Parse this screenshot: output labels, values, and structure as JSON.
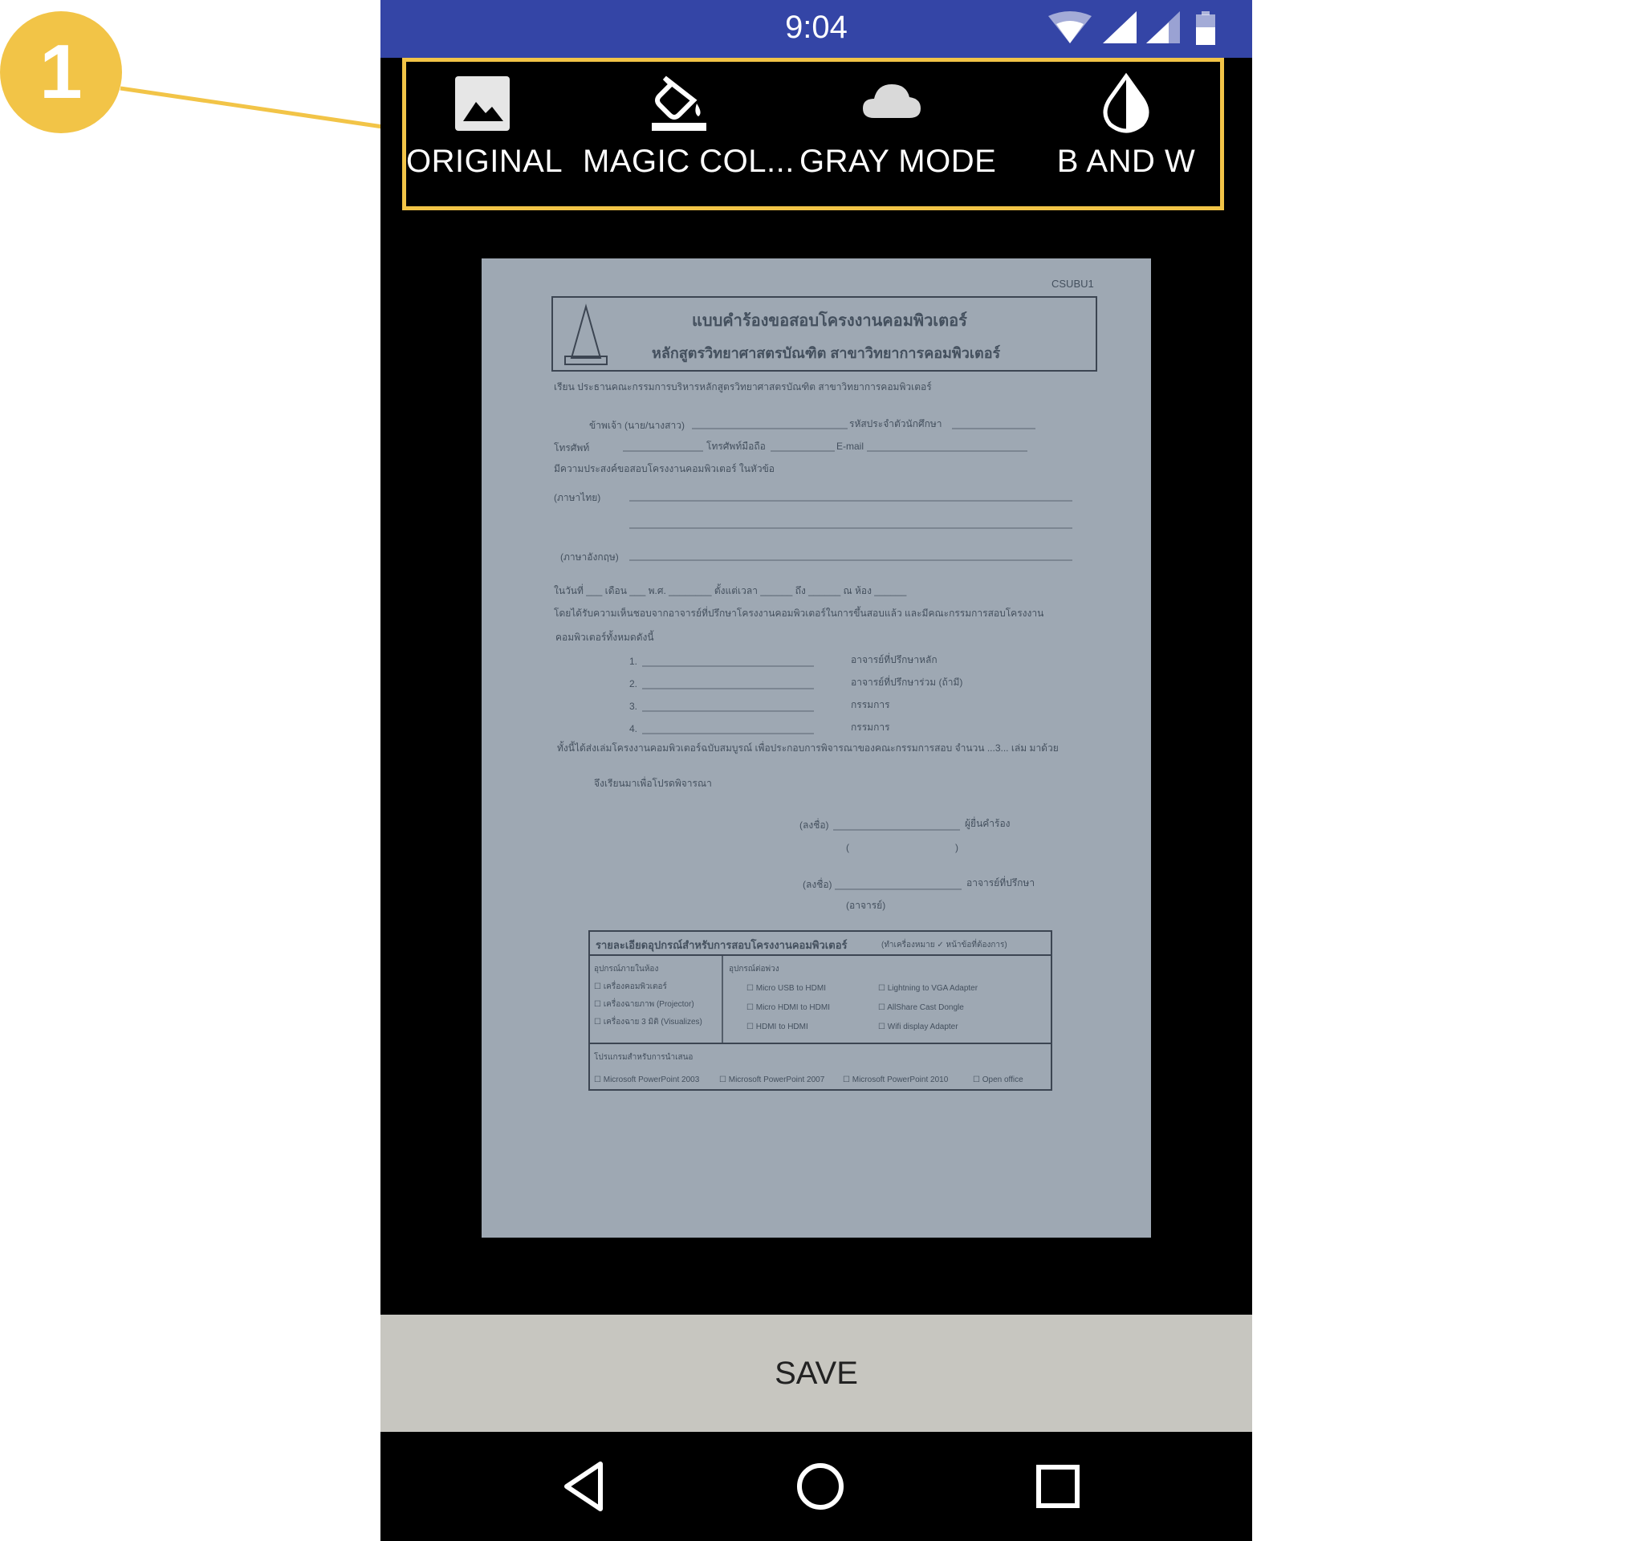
{
  "callout": {
    "number": "1",
    "color": "#f2c447"
  },
  "status_bar": {
    "time": "9:04",
    "background": "#3445a6",
    "icons": [
      "wifi-icon",
      "signal-icon",
      "signal-icon",
      "battery-icon"
    ]
  },
  "toolbar": {
    "items": [
      {
        "label": "ORIGINAL",
        "icon": "image-icon"
      },
      {
        "label": "MAGIC COL...",
        "icon": "paint-bucket-icon"
      },
      {
        "label": "GRAY MODE",
        "icon": "cloud-icon"
      },
      {
        "label": "B AND W",
        "icon": "contrast-drop-icon"
      }
    ],
    "highlight_color": "#f2c447"
  },
  "document": {
    "code": "CSUBU1",
    "title": "แบบคำร้องขอสอบโครงงานคอมพิวเตอร์",
    "subtitle": "หลักสูตรวิทยาศาสตรบัณฑิต สาขาวิทยาการคอมพิวเตอร์",
    "to_line": "เรียน ประธานคณะกรรมการบริหารหลักสูตรวิทยาศาสตรบัณฑิต สาขาวิทยาการคอมพิวเตอร์",
    "name_line": "ข้าพเจ้า (นาย/นางสาว)",
    "student_id": "รหัสประจำตัวนักศึกษา",
    "phone": "โทรศัพท์",
    "mobile": "โทรศัพท์มือถือ",
    "email": "E-mail",
    "purpose": "มีความประสงค์ขอสอบโครงงานคอมพิวเตอร์ ในหัวข้อ",
    "thai": "(ภาษาไทย)",
    "english": "(ภาษาอังกฤษ)",
    "date_line": "ในวันที่ ___ เดือน ___ พ.ศ. ________ ตั้งแต่เวลา ______ ถึง ______ ณ ห้อง ______",
    "approval_line": "โดยได้รับความเห็นชอบจากอาจารย์ที่ปรึกษาโครงงานคอมพิวเตอร์ในการขึ้นสอบแล้ว และมีคณะกรรมการสอบโครงงาน",
    "approval_line2": "คอมพิวเตอร์ทั้งหมดดังนี้",
    "committee": [
      {
        "no": "1.",
        "role": "อาจารย์ที่ปรึกษาหลัก"
      },
      {
        "no": "2.",
        "role": "อาจารย์ที่ปรึกษาร่วม (ถ้ามี)"
      },
      {
        "no": "3.",
        "role": "กรรมการ"
      },
      {
        "no": "4.",
        "role": "กรรมการ"
      }
    ],
    "submit_line": "ทั้งนี้ได้ส่งเล่มโครงงานคอมพิวเตอร์ฉบับสมบูรณ์ เพื่อประกอบการพิจารณาของคณะกรรมการสอบ จำนวน ...3... เล่ม มาด้วย",
    "closing": "จึงเรียนมาเพื่อโปรดพิจารณา",
    "sign1": "(ลงชื่อ)",
    "applicant": "ผู้ยื่นคำร้อง",
    "sign2": "(ลงชื่อ)",
    "advisor": "อาจารย์ที่ปรึกษา",
    "advisor_paren": "(อาจารย์)",
    "equip_title": "รายละเอียดอุปกรณ์สำหรับการสอบโครงงานคอมพิวเตอร์",
    "equip_note": "(ทำเครื่องหมาย ✓ หน้าข้อที่ต้องการ)",
    "room_equip_head": "อุปกรณ์ภายในห้อง",
    "room_equip": [
      "เครื่องคอมพิวเตอร์",
      "เครื่องฉายภาพ (Projector)",
      "เครื่องฉาย 3 มิติ (Visualizes)"
    ],
    "connectors_head": "อุปกรณ์ต่อพ่วง",
    "connectors_a": [
      "Micro USB to HDMI",
      "Micro HDMI to HDMI",
      "HDMI to HDMI"
    ],
    "connectors_b": [
      "Lightning to VGA Adapter",
      "AllShare Cast Dongle",
      "Wifi display Adapter"
    ],
    "software_head": "โปรแกรมสำหรับการนำเสนอ",
    "software": [
      "Microsoft PowerPoint 2003",
      "Microsoft PowerPoint 2007",
      "Microsoft PowerPoint 2010",
      "Open office"
    ]
  },
  "save_button": {
    "label": "SAVE",
    "background": "#c7c6c0"
  },
  "nav_bar": {
    "buttons": [
      "back-icon",
      "home-icon",
      "recents-icon"
    ]
  }
}
